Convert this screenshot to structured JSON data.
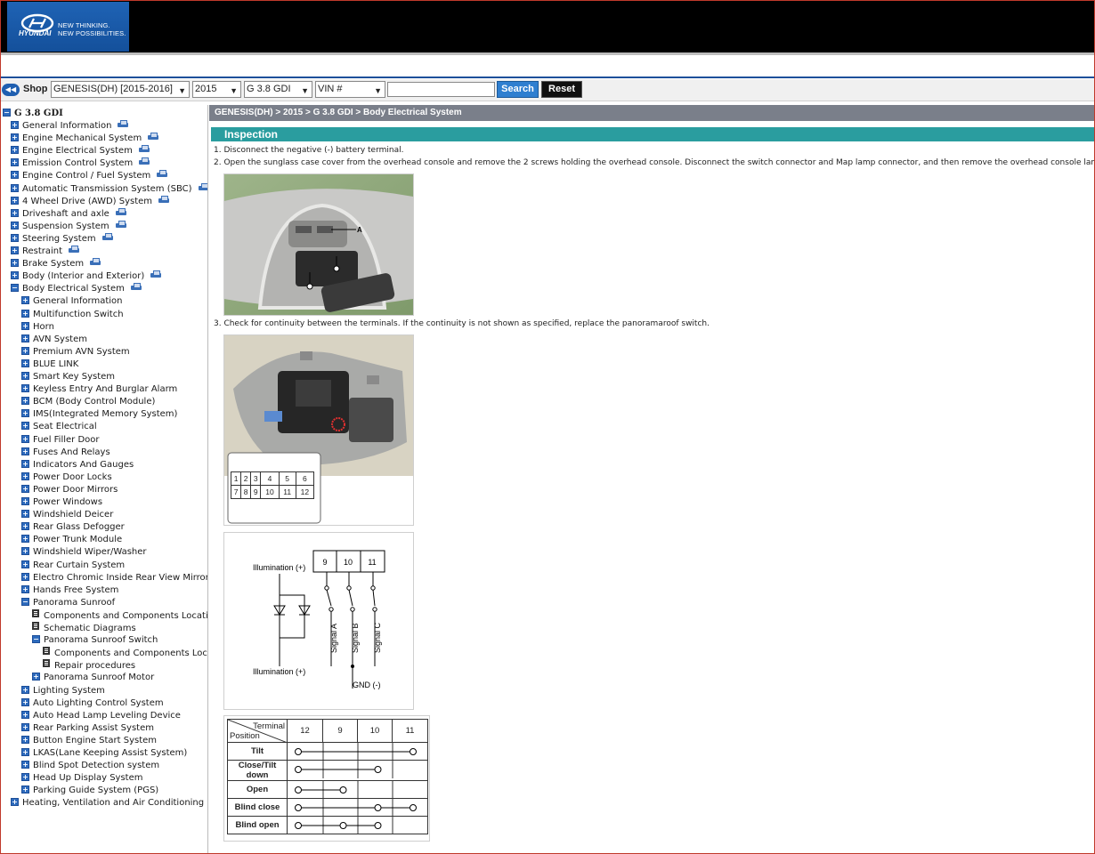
{
  "header": {
    "brand": "HYUNDAI",
    "slogan_line1": "NEW THINKING.",
    "slogan_line2": "NEW POSSIBILITIES."
  },
  "toolbar": {
    "shop_label": "Shop",
    "model_select": "GENESIS(DH) [2015-2016]",
    "year_select": "2015",
    "engine_select": "G 3.8 GDI",
    "vin_select": "VIN #",
    "search_value": "",
    "search_label": "Search",
    "reset_label": "Reset"
  },
  "tree": {
    "root": "G 3.8 GDI",
    "items": [
      {
        "label": "General Information",
        "level": 1,
        "icon": "plus",
        "printer": true
      },
      {
        "label": "Engine Mechanical System",
        "level": 1,
        "icon": "plus",
        "printer": true
      },
      {
        "label": "Engine Electrical System",
        "level": 1,
        "icon": "plus",
        "printer": true
      },
      {
        "label": "Emission Control System",
        "level": 1,
        "icon": "plus",
        "printer": true
      },
      {
        "label": "Engine Control / Fuel System",
        "level": 1,
        "icon": "plus",
        "printer": true
      },
      {
        "label": "Automatic Transmission System (SBC)",
        "level": 1,
        "icon": "plus",
        "printer": true
      },
      {
        "label": "4 Wheel Drive (AWD) System",
        "level": 1,
        "icon": "plus",
        "printer": true
      },
      {
        "label": "Driveshaft and axle",
        "level": 1,
        "icon": "plus",
        "printer": true
      },
      {
        "label": "Suspension System",
        "level": 1,
        "icon": "plus",
        "printer": true
      },
      {
        "label": "Steering System",
        "level": 1,
        "icon": "plus",
        "printer": true
      },
      {
        "label": "Restraint",
        "level": 1,
        "icon": "plus",
        "printer": true
      },
      {
        "label": "Brake System",
        "level": 1,
        "icon": "plus",
        "printer": true
      },
      {
        "label": "Body (Interior and Exterior)",
        "level": 1,
        "icon": "plus",
        "printer": true
      },
      {
        "label": "Body Electrical System",
        "level": 1,
        "icon": "minus",
        "printer": true
      },
      {
        "label": "General Information",
        "level": 2,
        "icon": "plus",
        "printer": false
      },
      {
        "label": "Multifunction Switch",
        "level": 2,
        "icon": "plus",
        "printer": false
      },
      {
        "label": "Horn",
        "level": 2,
        "icon": "plus",
        "printer": false
      },
      {
        "label": "AVN System",
        "level": 2,
        "icon": "plus",
        "printer": false
      },
      {
        "label": "Premium AVN System",
        "level": 2,
        "icon": "plus",
        "printer": false
      },
      {
        "label": "BLUE LINK",
        "level": 2,
        "icon": "plus",
        "printer": false
      },
      {
        "label": "Smart Key System",
        "level": 2,
        "icon": "plus",
        "printer": false
      },
      {
        "label": "Keyless Entry And Burglar Alarm",
        "level": 2,
        "icon": "plus",
        "printer": false
      },
      {
        "label": "BCM (Body Control Module)",
        "level": 2,
        "icon": "plus",
        "printer": false
      },
      {
        "label": "IMS(Integrated Memory System)",
        "level": 2,
        "icon": "plus",
        "printer": false
      },
      {
        "label": "Seat Electrical",
        "level": 2,
        "icon": "plus",
        "printer": false
      },
      {
        "label": "Fuel Filler Door",
        "level": 2,
        "icon": "plus",
        "printer": false
      },
      {
        "label": "Fuses And Relays",
        "level": 2,
        "icon": "plus",
        "printer": false
      },
      {
        "label": "Indicators And Gauges",
        "level": 2,
        "icon": "plus",
        "printer": false
      },
      {
        "label": "Power Door Locks",
        "level": 2,
        "icon": "plus",
        "printer": false
      },
      {
        "label": "Power Door Mirrors",
        "level": 2,
        "icon": "plus",
        "printer": false
      },
      {
        "label": "Power Windows",
        "level": 2,
        "icon": "plus",
        "printer": false
      },
      {
        "label": "Windshield Deicer",
        "level": 2,
        "icon": "plus",
        "printer": false
      },
      {
        "label": "Rear Glass Defogger",
        "level": 2,
        "icon": "plus",
        "printer": false
      },
      {
        "label": "Power Trunk Module",
        "level": 2,
        "icon": "plus",
        "printer": false
      },
      {
        "label": "Windshield Wiper/Washer",
        "level": 2,
        "icon": "plus",
        "printer": false
      },
      {
        "label": "Rear Curtain System",
        "level": 2,
        "icon": "plus",
        "printer": false
      },
      {
        "label": "Electro Chromic Inside Rear View Mirror",
        "level": 2,
        "icon": "plus",
        "printer": false
      },
      {
        "label": "Hands Free System",
        "level": 2,
        "icon": "plus",
        "printer": false
      },
      {
        "label": "Panorama Sunroof",
        "level": 2,
        "icon": "minus",
        "printer": false
      },
      {
        "label": "Components and Components Location",
        "level": 3,
        "icon": "doc",
        "printer": false
      },
      {
        "label": "Schematic Diagrams",
        "level": 3,
        "icon": "doc",
        "printer": false
      },
      {
        "label": "Panorama Sunroof Switch",
        "level": 3,
        "icon": "minus",
        "printer": false
      },
      {
        "label": "Components and Components Locatio",
        "level": 4,
        "icon": "doc",
        "printer": false
      },
      {
        "label": "Repair procedures",
        "level": 4,
        "icon": "doc",
        "printer": false
      },
      {
        "label": "Panorama Sunroof Motor",
        "level": 3,
        "icon": "plus",
        "printer": false
      },
      {
        "label": "Lighting System",
        "level": 2,
        "icon": "plus",
        "printer": false
      },
      {
        "label": "Auto Lighting Control System",
        "level": 2,
        "icon": "plus",
        "printer": false
      },
      {
        "label": "Auto Head Lamp Leveling Device",
        "level": 2,
        "icon": "plus",
        "printer": false
      },
      {
        "label": "Rear Parking Assist System",
        "level": 2,
        "icon": "plus",
        "printer": false
      },
      {
        "label": "Button Engine Start System",
        "level": 2,
        "icon": "plus",
        "printer": false
      },
      {
        "label": "LKAS(Lane Keeping Assist System)",
        "level": 2,
        "icon": "plus",
        "printer": false
      },
      {
        "label": "Blind Spot Detection system",
        "level": 2,
        "icon": "plus",
        "printer": false
      },
      {
        "label": "Head Up Display System",
        "level": 2,
        "icon": "plus",
        "printer": false
      },
      {
        "label": "Parking Guide System (PGS)",
        "level": 2,
        "icon": "plus",
        "printer": false
      },
      {
        "label": "Heating, Ventilation and Air Conditioning",
        "level": 1,
        "icon": "plus",
        "printer": true
      }
    ]
  },
  "content": {
    "breadcrumb": "GENESIS(DH) > 2015 > G 3.8 GDI > Body Electrical System",
    "section_title": "Inspection",
    "step1": "1.  Disconnect the negative (-) battery terminal.",
    "step2": "2.  Open the sunglass case cover from the overhead console and remove the 2 screws holding the overhead console. Disconnect the switch connector and Map lamp connector, and then remove the overhead console lamp (A).",
    "step3": "3.  Check for continuity between the terminals. If the continuity is not shown as specified, replace the panoramaroof switch.",
    "fig1_label": "A",
    "connector_pins_top": [
      "1",
      "2",
      "3",
      "4",
      "5",
      "6"
    ],
    "connector_pins_bottom": [
      "7",
      "8",
      "9",
      "10",
      "11",
      "12"
    ],
    "schematic": {
      "terminals": [
        "9",
        "10",
        "11"
      ],
      "illum_top": "Illumination (+)",
      "illum_bottom": "Illumination (+)",
      "signals": [
        "Signal A",
        "Signal B",
        "Signal C"
      ],
      "gnd": "GND (-)"
    },
    "table": {
      "corner_terminal": "Terminal",
      "corner_position": "Position",
      "columns": [
        "12",
        "9",
        "10",
        "11"
      ],
      "rows": [
        {
          "label": "Tilt",
          "from": 0,
          "to": 3,
          "mid": []
        },
        {
          "label": "Close/Tilt down",
          "from": 0,
          "to": 2,
          "mid": []
        },
        {
          "label": "Open",
          "from": 0,
          "to": 1,
          "mid": []
        },
        {
          "label": "Blind close",
          "from": 0,
          "to": 3,
          "mid": [
            2
          ]
        },
        {
          "label": "Blind open",
          "from": 0,
          "to": 2,
          "mid": [
            1
          ]
        }
      ]
    }
  }
}
